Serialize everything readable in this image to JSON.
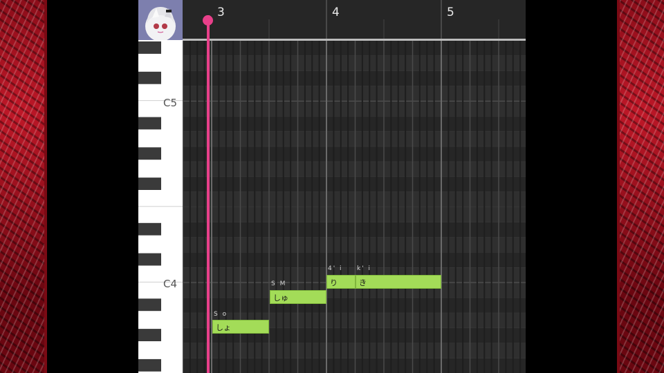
{
  "ruler": {
    "bars": [
      "3",
      "4",
      "5"
    ]
  },
  "keyboard": {
    "octave_labels": [
      "C5",
      "C4"
    ]
  },
  "notes": [
    {
      "lyric": "しょ",
      "phoneme": "S o"
    },
    {
      "lyric": "しゅ",
      "phoneme": "S M"
    },
    {
      "lyric": "り",
      "phoneme": "4' i"
    },
    {
      "lyric": "き",
      "phoneme": "k' i"
    }
  ],
  "colors": {
    "note_fill": "#a3dc58",
    "playhead": "#e8408a",
    "grid_background": "#2d2d2d",
    "side_art": "#c01828"
  },
  "icons": {
    "avatar": "singer-avatar",
    "playhead": "playhead-marker-icon"
  }
}
